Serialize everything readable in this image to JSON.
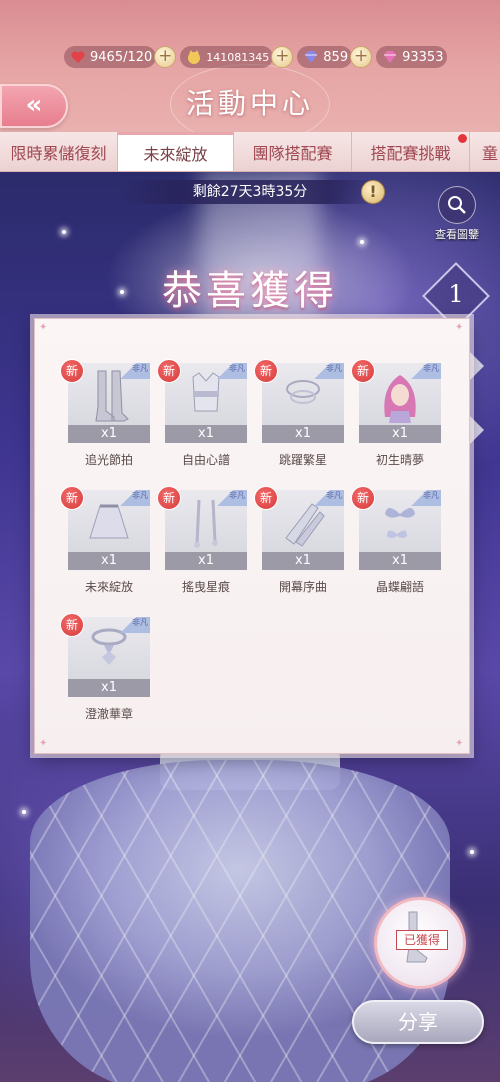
{
  "currency": {
    "stamina": "9465/120",
    "gold": "141081345",
    "diamond": "859",
    "gem": "93353"
  },
  "header": {
    "title": "活動中心",
    "back_label": "«"
  },
  "tabs": [
    {
      "label": "限時累儲復刻"
    },
    {
      "label": "未來綻放"
    },
    {
      "label": "團隊搭配賽"
    },
    {
      "label": "搭配賽挑戰"
    },
    {
      "label": "童"
    }
  ],
  "countdown": "剩餘27天3時35分",
  "warn_symbol": "!",
  "gallery_label": "查看圖鑒",
  "congrats_title": "恭喜獲得",
  "page_number": "1",
  "items": [
    {
      "name": "追光節拍",
      "qty": "x1",
      "new": "新",
      "tag": "非凡"
    },
    {
      "name": "自由心譜",
      "qty": "x1",
      "new": "新",
      "tag": "非凡"
    },
    {
      "name": "跳躍繁星",
      "qty": "x1",
      "new": "新",
      "tag": "非凡"
    },
    {
      "name": "初生晴夢",
      "qty": "x1",
      "new": "新",
      "tag": "非凡"
    },
    {
      "name": "未來綻放",
      "qty": "x1",
      "new": "新",
      "tag": "非凡"
    },
    {
      "name": "搖曳星痕",
      "qty": "x1",
      "new": "新",
      "tag": "非凡"
    },
    {
      "name": "開幕序曲",
      "qty": "x1",
      "new": "新",
      "tag": "非凡"
    },
    {
      "name": "晶蝶翩語",
      "qty": "x1",
      "new": "新",
      "tag": "非凡"
    },
    {
      "name": "澄澈華章",
      "qty": "x1",
      "new": "新",
      "tag": "非凡"
    }
  ],
  "obtained_label": "已獲得",
  "share_label": "分享"
}
